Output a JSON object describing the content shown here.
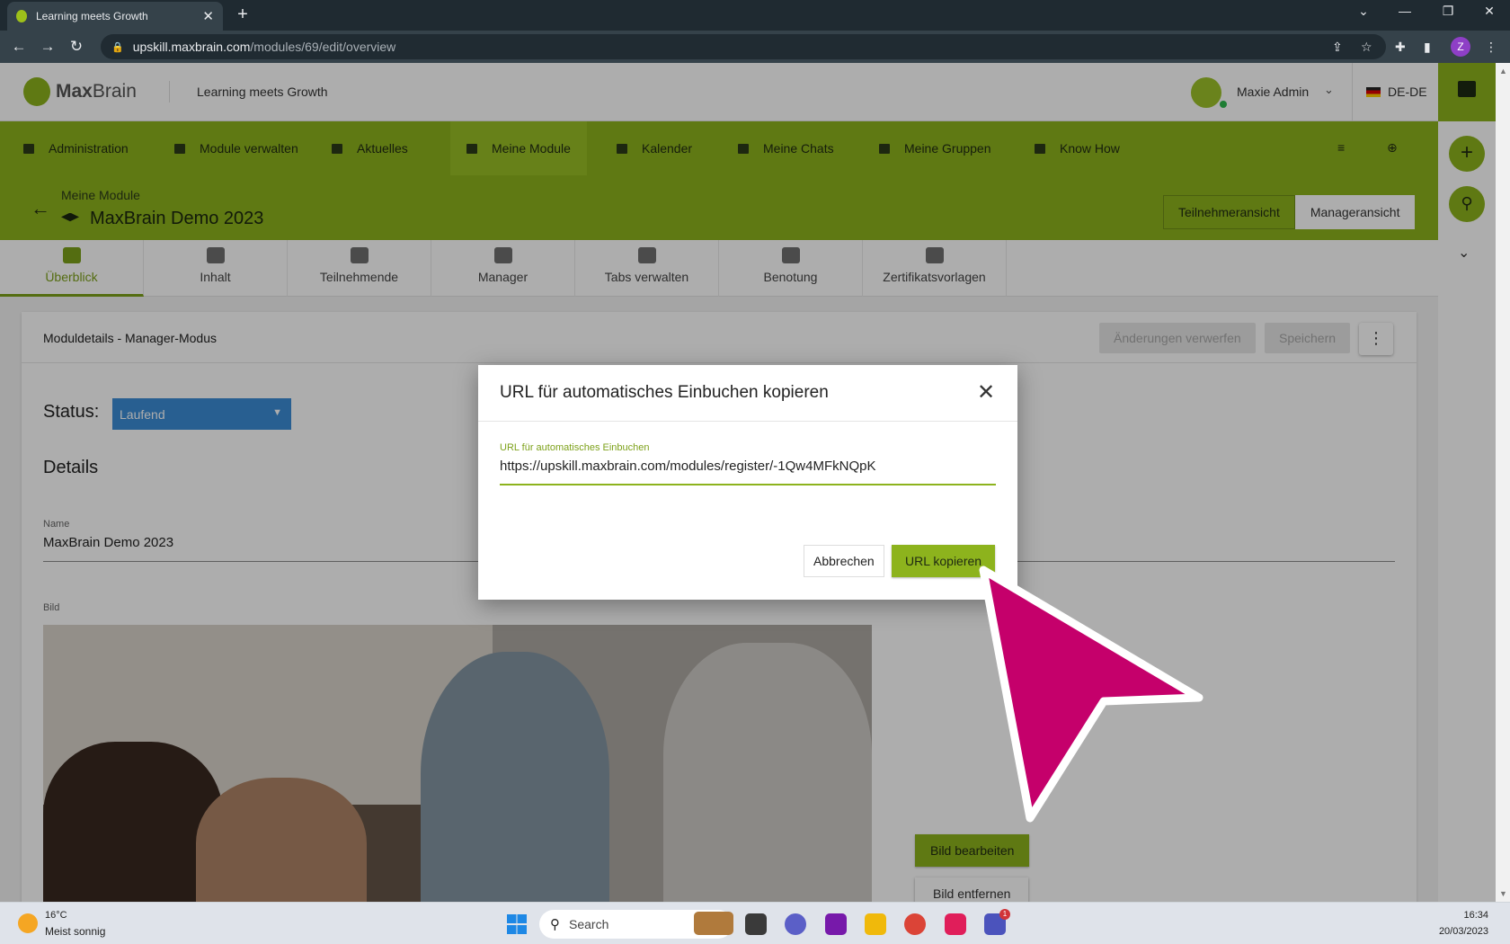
{
  "browser": {
    "tab_title": "Learning meets Growth",
    "url_host": "upskill.maxbrain.com",
    "url_path": "/modules/69/edit/overview"
  },
  "header": {
    "logo_bold": "Max",
    "logo_regular": "Brain",
    "slogan": "Learning meets Growth",
    "user_name": "Maxie Admin",
    "language": "DE-DE"
  },
  "nav": {
    "items": [
      {
        "label": "Administration",
        "icon": "grid-icon"
      },
      {
        "label": "Module verwalten",
        "icon": "folder-icon"
      },
      {
        "label": "Aktuelles",
        "icon": "news-icon"
      },
      {
        "label": "Meine Module",
        "icon": "graduation-cap-icon",
        "active": true
      },
      {
        "label": "Kalender",
        "icon": "calendar-icon"
      },
      {
        "label": "Meine Chats",
        "icon": "chat-icon"
      },
      {
        "label": "Meine Gruppen",
        "icon": "group-folder-icon"
      },
      {
        "label": "Know How",
        "icon": "book-icon"
      }
    ]
  },
  "module": {
    "breadcrumb": "Meine Module",
    "title": "MaxBrain Demo 2023",
    "view_participant": "Teilnehmeransicht",
    "view_manager": "Manageransicht"
  },
  "tabs": [
    {
      "label": "Überblick",
      "icon": "dashboard-icon",
      "active": true
    },
    {
      "label": "Inhalt",
      "icon": "folder-icon"
    },
    {
      "label": "Teilnehmende",
      "icon": "people-icon"
    },
    {
      "label": "Manager",
      "icon": "manager-icon"
    },
    {
      "label": "Tabs verwalten",
      "icon": "window-icon"
    },
    {
      "label": "Benotung",
      "icon": "grade-file-icon"
    },
    {
      "label": "Zertifikatsvorlagen",
      "icon": "certificate-file-icon"
    }
  ],
  "card": {
    "title": "Moduldetails - Manager-Modus",
    "discard_label": "Änderungen verwerfen",
    "save_label": "Speichern",
    "status_label": "Status:",
    "status_value": "Laufend",
    "details_heading": "Details",
    "name_label": "Name",
    "name_value": "MaxBrain Demo 2023",
    "image_label": "Bild",
    "edit_image_label": "Bild bearbeiten",
    "remove_image_label": "Bild entfernen"
  },
  "dialog": {
    "title": "URL für automatisches Einbuchen kopieren",
    "field_label": "URL für automatisches Einbuchen",
    "field_value": "https://upskill.maxbrain.com/modules/register/-1Qw4MFkNQpK",
    "cancel_label": "Abbrechen",
    "copy_label": "URL kopieren"
  },
  "taskbar": {
    "temperature": "16°C",
    "weather": "Meist sonnig",
    "search_label": "Search",
    "time": "16:34",
    "date": "20/03/2023",
    "teams_badge": "1"
  },
  "colors": {
    "brand_green": "#8db31d",
    "status_blue": "#3b8cd6",
    "pointer_magenta": "#c5006b"
  }
}
